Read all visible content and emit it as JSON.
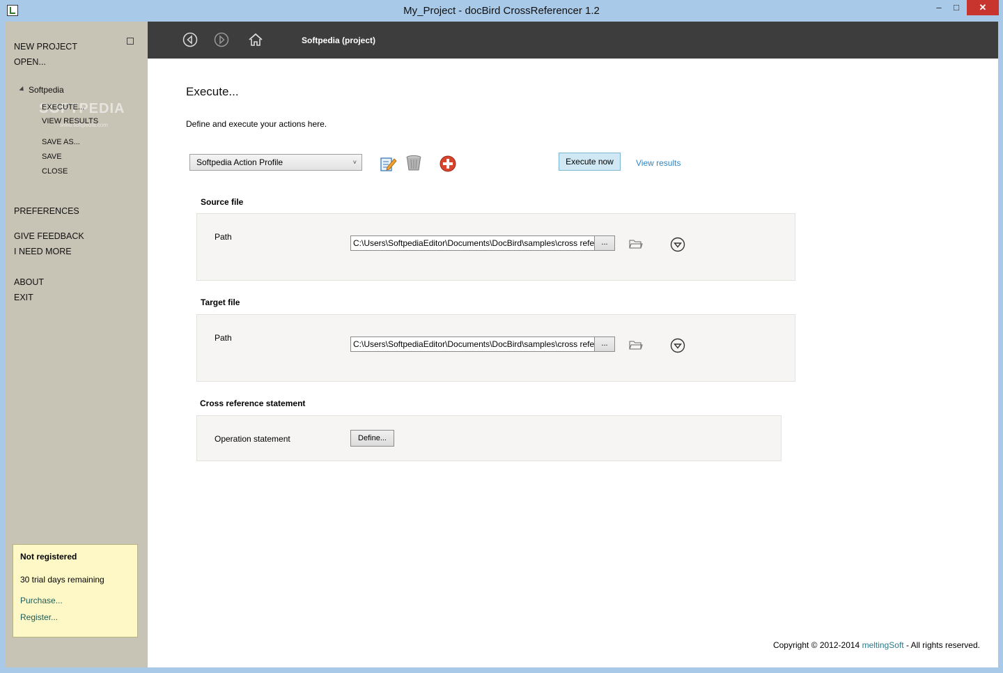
{
  "window": {
    "title": "My_Project - docBird CrossReferencer 1.2",
    "min_label": "–",
    "max_label": "□",
    "close_label": "✕"
  },
  "sidebar": {
    "new_project": "NEW PROJECT",
    "open": "OPEN...",
    "tree_node": "Softpedia",
    "watermark": "SOFTPEDIA",
    "watermark_sub": "www.softpedia.com",
    "sub_items": [
      "EXECUTE...",
      "VIEW RESULTS",
      "SAVE AS...",
      "SAVE",
      "CLOSE"
    ],
    "preferences": "PREFERENCES",
    "give_feedback": "GIVE FEEDBACK",
    "i_need_more": "I NEED MORE",
    "about": "ABOUT",
    "exit": "EXIT"
  },
  "registration": {
    "title": "Not registered",
    "days": "30 trial days remaining",
    "purchase": "Purchase...",
    "register": "Register..."
  },
  "header": {
    "breadcrumb": "Softpedia (project)",
    "icons": [
      "back-icon",
      "forward-icon",
      "home-icon"
    ]
  },
  "main": {
    "title": "Execute...",
    "description": "Define and execute your actions here.",
    "profile_selected": "Softpedia Action Profile",
    "profile_chevron": "˅",
    "execute_now": "Execute now",
    "view_results": "View results",
    "source": {
      "label": "Source file",
      "path_label": "Path",
      "path_value": "C:\\Users\\SoftpediaEditor\\Documents\\DocBird\\samples\\cross reference\\Source.docx",
      "browse": "..."
    },
    "target": {
      "label": "Target file",
      "path_label": "Path",
      "path_value": "C:\\Users\\SoftpediaEditor\\Documents\\DocBird\\samples\\cross reference\\Target.docx",
      "browse": "..."
    },
    "cross_ref": {
      "label": "Cross reference statement",
      "operation_label": "Operation statement",
      "define": "Define..."
    }
  },
  "footer": {
    "copyright_prefix": "Copyright © 2012-2014",
    "brand": "meltingSoft",
    "suffix": " - All rights reserved."
  },
  "colors": {
    "sidebar_bg": "#c7c3b5",
    "header_bg": "#3d3d3d",
    "accent_link": "#2a86c8",
    "execute_bg": "#cfe8f3",
    "registration_bg": "#fdf8c6"
  }
}
